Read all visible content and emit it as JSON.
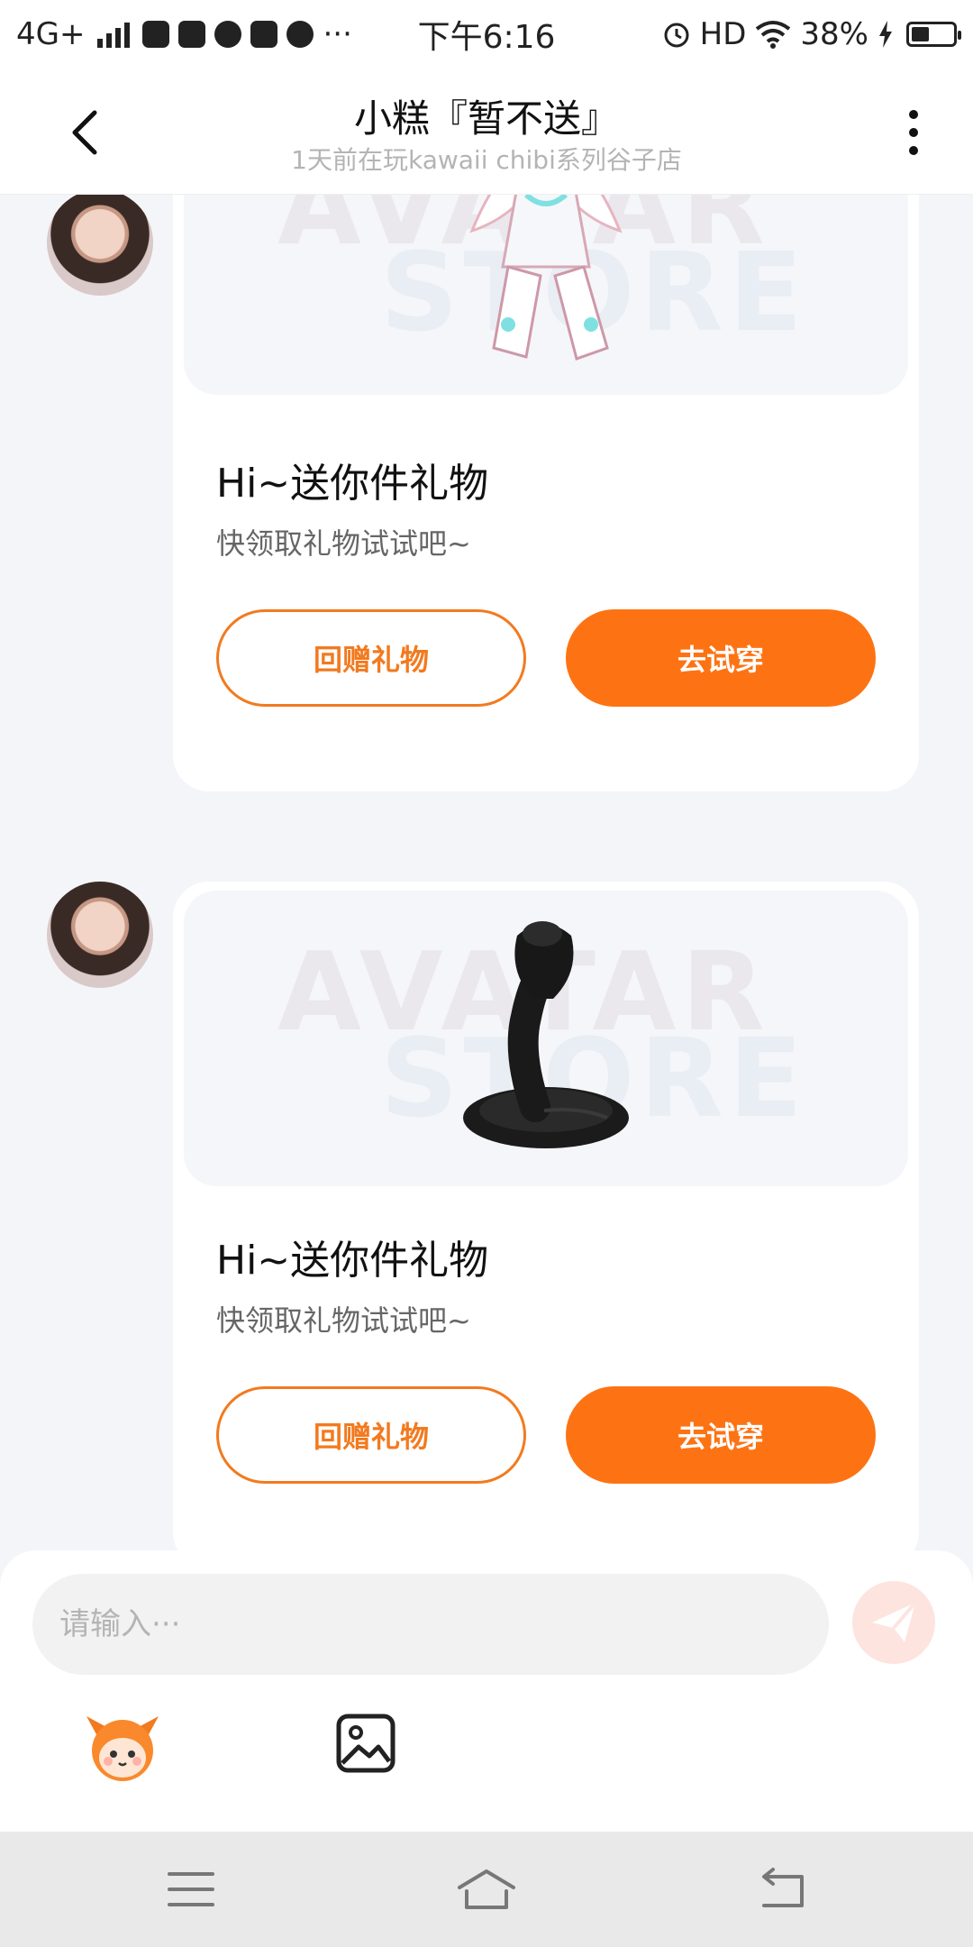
{
  "status_bar": {
    "network": "4G+",
    "time": "下午6:16",
    "hd": "HD",
    "battery": "38%",
    "battery_level": 0.38,
    "app_icons": [
      "message-icon",
      "music-icon",
      "video-icon",
      "pinwheel-icon",
      "planet-icon"
    ],
    "more": "···"
  },
  "header": {
    "title": "小糕『暂不送』",
    "subtitle": "1天前在玩kawaii chibi系列谷子店"
  },
  "messages": [
    {
      "watermark_line1": "AVATAR",
      "watermark_line2": "STORE",
      "gift_icon": "doll-dress-icon",
      "title": "Hi~送你件礼物",
      "subtitle": "快领取礼物试试吧~",
      "return_gift": "回赠礼物",
      "try_on": "去试穿"
    },
    {
      "watermark_line1": "AVATAR",
      "watermark_line2": "STORE",
      "gift_icon": "cobra-icon",
      "title": "Hi~送你件礼物",
      "subtitle": "快领取礼物试试吧~",
      "return_gift": "回赠礼物",
      "try_on": "去试穿"
    }
  ],
  "input": {
    "placeholder": "请输入···"
  },
  "colors": {
    "accent": "#fd7313",
    "outline": "#f27a1f",
    "send_bg": "#fde4df"
  }
}
